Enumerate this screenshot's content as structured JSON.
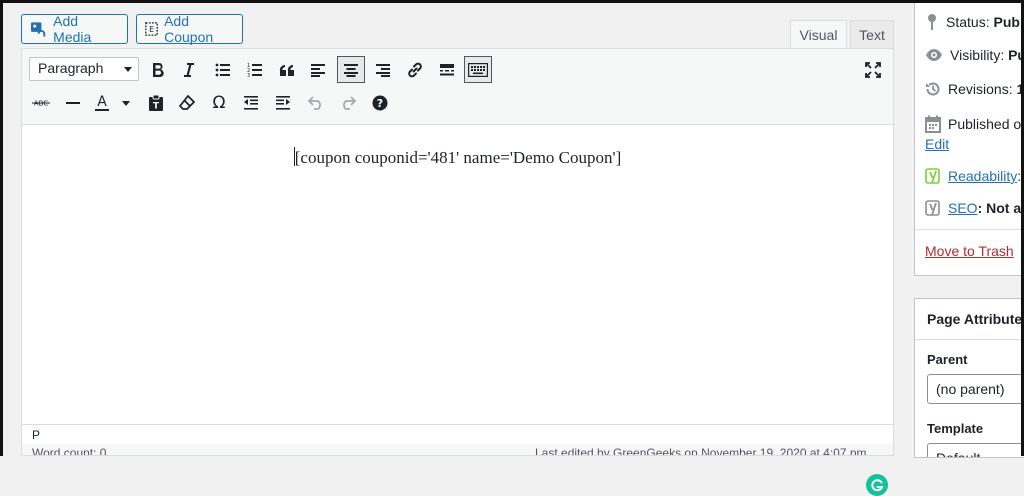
{
  "media_buttons": {
    "add_media": "Add Media",
    "add_coupon": "Add Coupon"
  },
  "editor_tabs": {
    "visual": "Visual",
    "text": "Text"
  },
  "toolbar": {
    "format_select": "Paragraph",
    "row1": [
      "bold-icon",
      "italic-icon",
      "bulleted-list-icon",
      "numbered-list-icon",
      "blockquote-icon",
      "align-left-icon",
      "align-center-icon",
      "align-right-icon",
      "link-icon",
      "read-more-icon",
      "toolbar-toggle-icon"
    ],
    "row2": [
      "strikethrough-icon",
      "horizontal-line-icon",
      "text-color-icon",
      "paste-as-text-icon",
      "clear-formatting-icon",
      "special-character-icon",
      "outdent-icon",
      "indent-icon",
      "undo-icon",
      "redo-icon",
      "help-icon"
    ],
    "fullscreen": "fullscreen-icon",
    "text_color_glyph": "A",
    "omega_glyph": "Ω",
    "strike_glyph": "ABC"
  },
  "content": {
    "text": "[coupon couponid='481' name='Demo Coupon']"
  },
  "path_bar": {
    "path": "P"
  },
  "status_bar": {
    "word_count": "Word count: 0",
    "last_edited": "Last edited by GreenGeeks on November 19, 2020 at 4:07 pm"
  },
  "publish": {
    "status_label": "Status:",
    "status_value": "Pub",
    "visibility_label": "Visibility:",
    "visibility_value": "Pu",
    "revisions_label": "Revisions:",
    "revisions_value": "1",
    "published_label": "Published o",
    "edit_link": "Edit",
    "readability_label": "Readability",
    "readability_suffix": ":",
    "seo_label": "SEO",
    "seo_value": ": Not av",
    "move_to_trash": "Move to Trash"
  },
  "page_attributes": {
    "title": "Page Attribute",
    "parent_label": "Parent",
    "parent_value": "(no parent)",
    "template_label": "Template",
    "template_value": "Default"
  },
  "colors": {
    "accent": "#2271b1",
    "trash": "#b32d2e",
    "grammarly": "#15c39a",
    "yoast": "#7ad03a"
  }
}
